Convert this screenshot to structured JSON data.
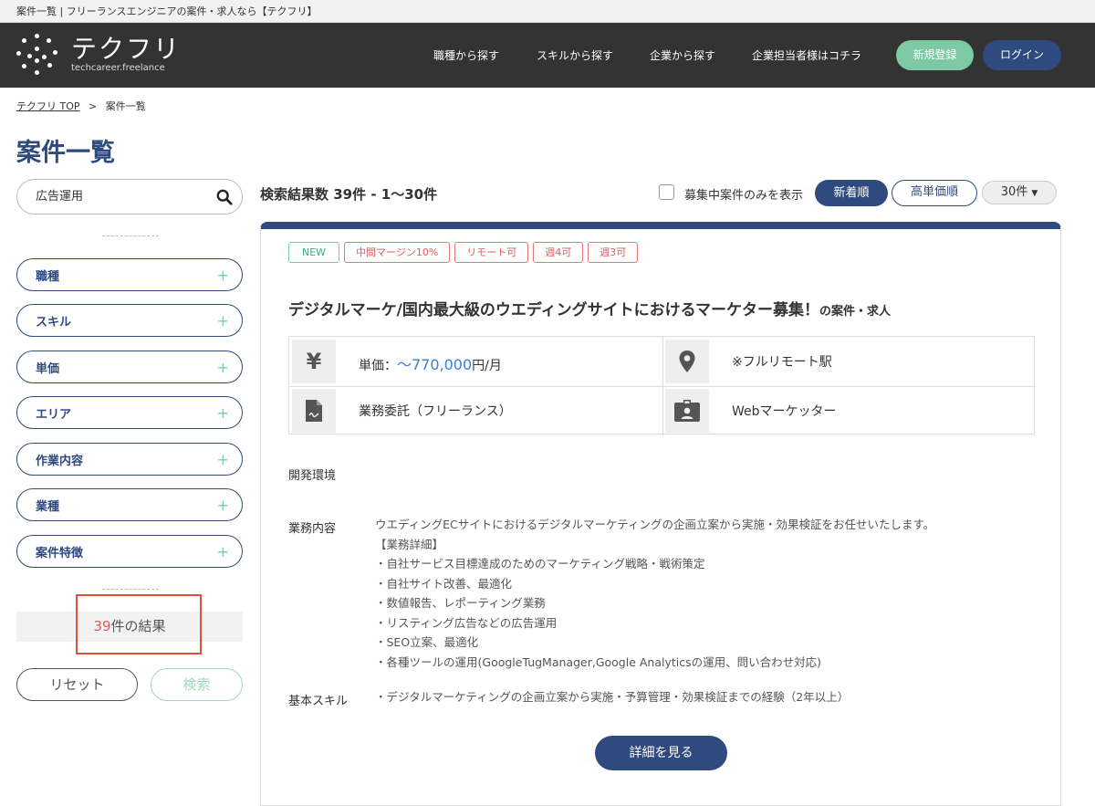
{
  "tab_title": "案件一覧 | フリーランスエンジニアの案件・求人なら【テクフリ】",
  "header": {
    "logo_main": "テクフリ",
    "logo_sub": "techcareer.freelance",
    "nav": [
      "職種から探す",
      "スキルから探す",
      "企業から探す",
      "企業担当者様はコチラ"
    ],
    "signup_label": "新規登録",
    "login_label": "ログイン",
    "colors": {
      "bar": "#333333",
      "signup": "#7dc9a3",
      "login": "#2f4a7f"
    }
  },
  "breadcrumb": {
    "top": "テクフリ TOP",
    "separator": ">",
    "current": "案件一覧"
  },
  "page_title": "案件一覧",
  "sidebar": {
    "search_value": "広告運用",
    "filters": [
      "職種",
      "スキル",
      "単価",
      "エリア",
      "作業内容",
      "業種",
      "案件特徴"
    ],
    "result_num": "39",
    "result_suffix": "件の結果",
    "reset_label": "リセット",
    "search_label": "検索"
  },
  "results": {
    "count_text": "検索結果数 39件 - 1〜30件",
    "only_open_label": "募集中案件のみを表示",
    "sort_new": "新着順",
    "sort_price": "高単価順",
    "per_page": "30件"
  },
  "job": {
    "tags": [
      "NEW",
      "中間マージン10%",
      "リモート可",
      "週4可",
      "週3可"
    ],
    "title": "デジタルマーケ/国内最大級のウエディングサイトにおけるマーケター募集！",
    "title_suffix": "の案件・求人",
    "price_prefix": "単価：",
    "price_value": "〜770,000",
    "price_unit": "円/月",
    "station": "※フルリモート駅",
    "contract": "業務委託（フリーランス）",
    "role": "Webマーケッター",
    "env_label": "開発環境",
    "work_label": "業務内容",
    "work_lines": [
      "ウエディングECサイトにおけるデジタルマーケティングの企画立案から実施・効果検証をお任せいたします。",
      "【業務詳細】",
      "・自社サービス目標達成のためのマーケティング戦略・戦術策定",
      "・自社サイト改善、最適化",
      "・数値報告、レポーティング業務",
      "・リスティング広告などの広告運用",
      "・SEO立案、最適化",
      "・各種ツールの運用(GoogleTugManager,Google Analyticsの運用、問い合わせ対応)"
    ],
    "skill_label": "基本スキル",
    "skill_text": "・デジタルマーケティングの企画立案から実施・予算管理・効果検証までの経験（2年以上）",
    "detail_label": "詳細を見る"
  }
}
